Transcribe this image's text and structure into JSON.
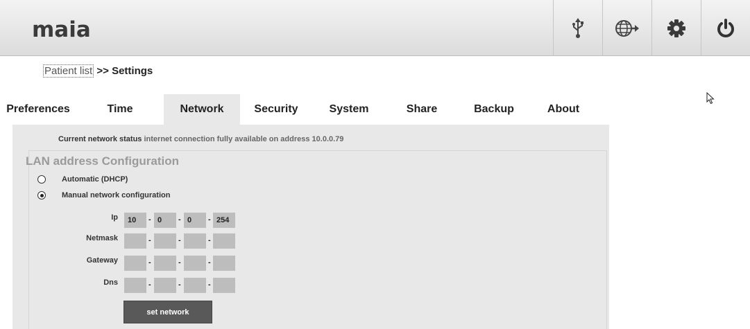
{
  "app": {
    "logo": "maia"
  },
  "toolbar": {
    "icons": [
      "usb-icon",
      "globe-arrow-icon",
      "gear-icon",
      "power-icon"
    ]
  },
  "breadcrumb": {
    "link": "Patient list",
    "separator": " >> ",
    "current": "Settings"
  },
  "tabs": [
    {
      "label": "Preferences"
    },
    {
      "label": "Time"
    },
    {
      "label": "Network",
      "active": true
    },
    {
      "label": "Security"
    },
    {
      "label": "System"
    },
    {
      "label": "Share"
    },
    {
      "label": "Backup"
    },
    {
      "label": "About"
    }
  ],
  "status": {
    "label": "Current network status",
    "value": "internet connection fully available on address 10.0.0.79"
  },
  "lan": {
    "legend": "LAN address Configuration",
    "options": [
      {
        "label": "Automatic (DHCP)",
        "checked": false
      },
      {
        "label": "Manual network configuration",
        "checked": true
      }
    ],
    "fields": [
      {
        "label": "Ip",
        "octets": [
          "10",
          "0",
          "0",
          "254"
        ]
      },
      {
        "label": "Netmask",
        "octets": [
          "",
          "",
          "",
          ""
        ]
      },
      {
        "label": "Gateway",
        "octets": [
          "",
          "",
          "",
          ""
        ]
      },
      {
        "label": "Dns",
        "octets": [
          "",
          "",
          "",
          ""
        ]
      }
    ],
    "separator": "-",
    "submit_label": "set network"
  }
}
